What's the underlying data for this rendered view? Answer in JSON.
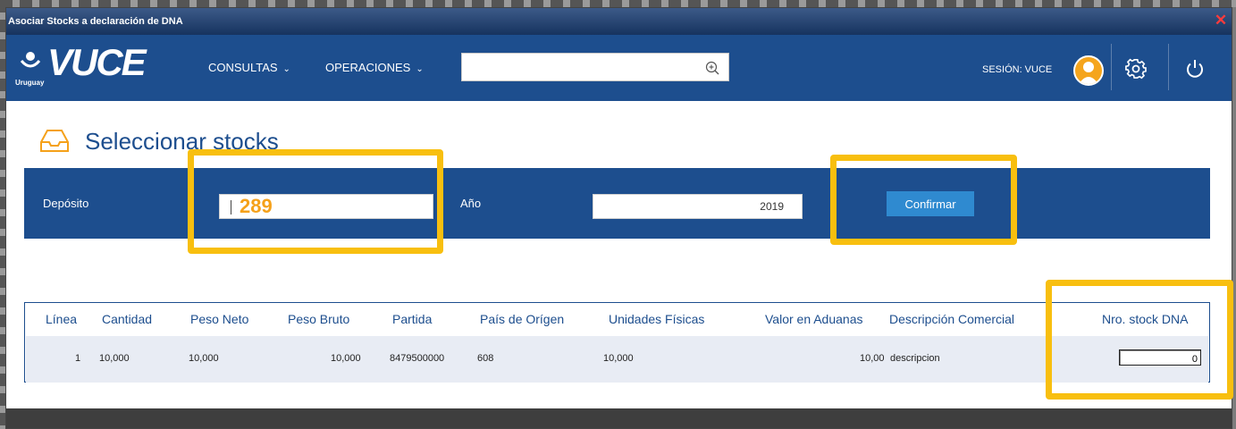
{
  "window": {
    "title": "Asociar Stocks a declaración de DNA",
    "close_glyph": "✕"
  },
  "navbar": {
    "logo_text": "VUCE",
    "logo_sub": "Uruguay",
    "menu": [
      {
        "label": "CONSULTAS",
        "chevron": "⌄"
      },
      {
        "label": "OPERACIONES",
        "chevron": "⌄"
      }
    ],
    "search": {
      "value": "",
      "placeholder": "",
      "icon": "zoom-in-icon"
    },
    "session_label": "SESIÓN: VUCE",
    "icons": [
      "user-avatar-icon",
      "gear-icon",
      "power-icon"
    ]
  },
  "page": {
    "title": "Seleccionar stocks",
    "icon": "inbox-tray-icon"
  },
  "filters": {
    "deposito_label": "Depósito",
    "deposito_value": "289",
    "anio_label": "Año",
    "anio_value": "2019",
    "confirm_label": "Confirmar"
  },
  "table": {
    "columns": [
      "Línea",
      "Cantidad",
      "Peso Neto",
      "Peso Bruto",
      "Partida",
      "País de Orígen",
      "Unidades Físicas",
      "Valor en Aduanas",
      "Descripción Comercial",
      "Nro. stock DNA"
    ],
    "rows": [
      {
        "linea": "1",
        "cantidad": "10,000",
        "peso_neto": "10,000",
        "peso_bruto": "10,000",
        "partida": "8479500000",
        "pais": "608",
        "unidades": "10,000",
        "valor": "10,00",
        "descripcion": "descripcion",
        "nro_stock": "0"
      }
    ]
  },
  "colors": {
    "brand_blue": "#1d4e8e",
    "highlight": "#f8bf0f",
    "button_blue": "#2f8ad0",
    "avatar": "#f5a51d"
  }
}
